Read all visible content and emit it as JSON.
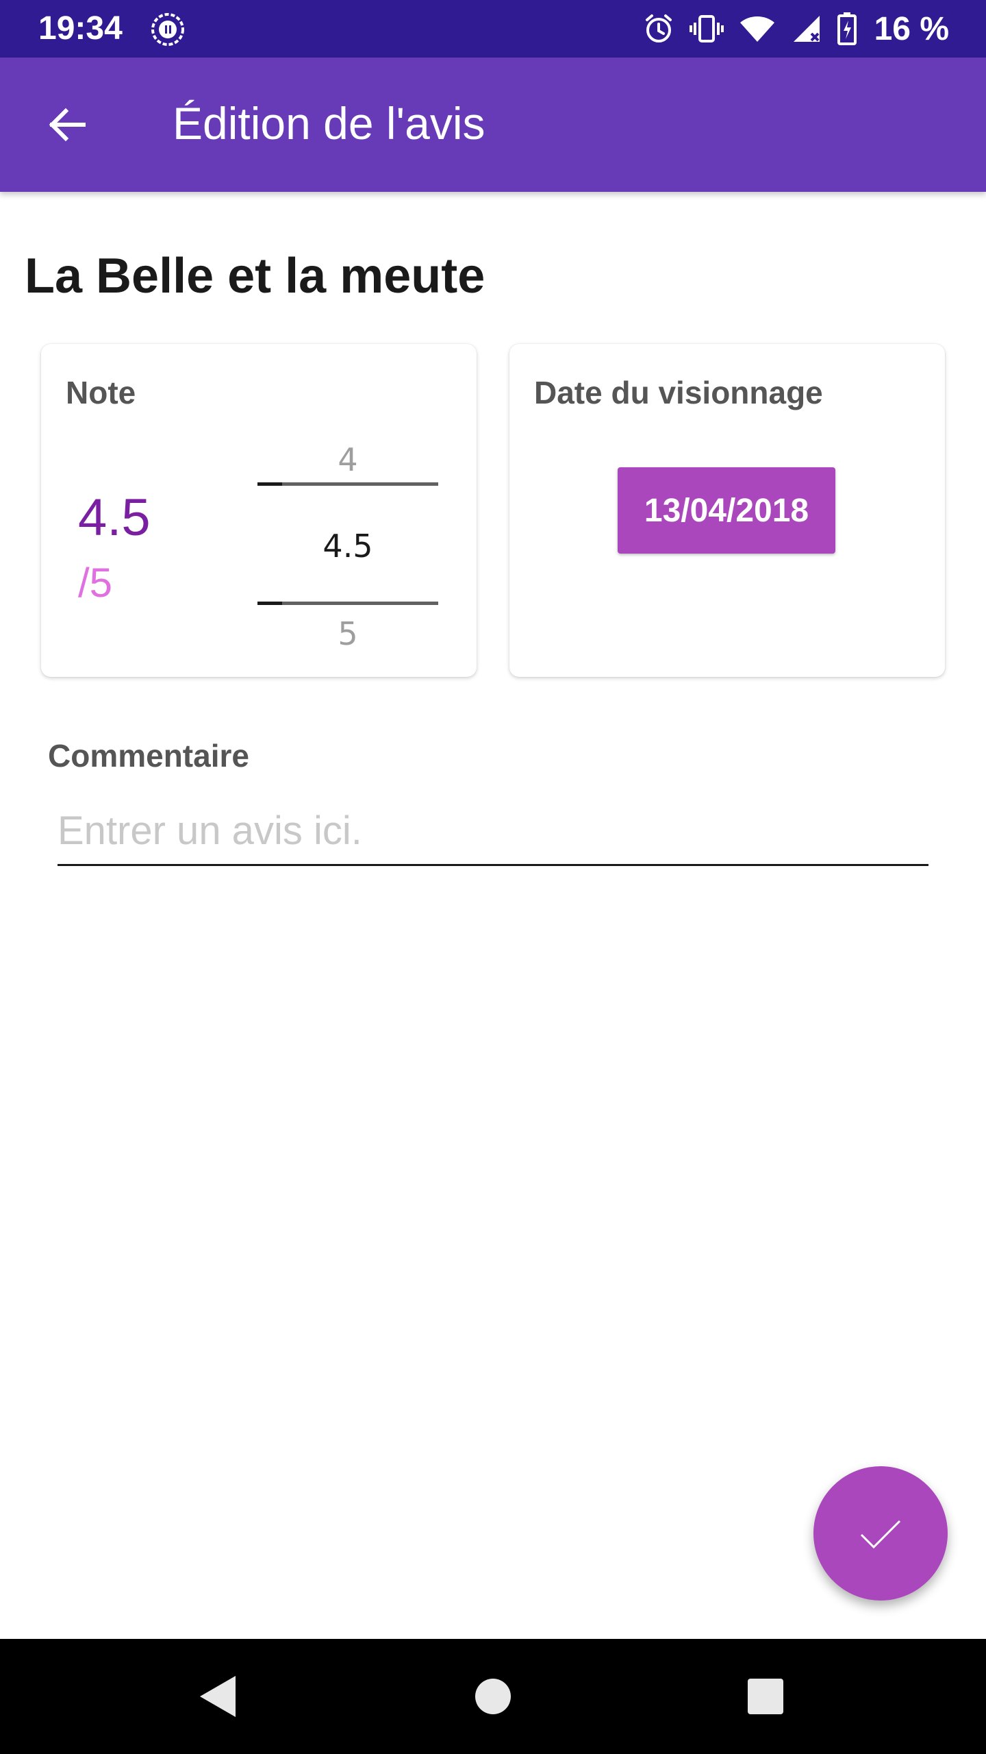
{
  "status_bar": {
    "time": "19:34",
    "battery": "16 %",
    "icons": [
      "app-notification-icon",
      "alarm-icon",
      "vibrate-icon",
      "wifi-icon",
      "signal-icon",
      "battery-charging-icon"
    ]
  },
  "app_bar": {
    "title": "Édition de l'avis",
    "back_icon": "arrow-back-icon",
    "color": "#673ab7"
  },
  "movie": {
    "title": "La Belle et la meute"
  },
  "rating_card": {
    "label": "Note",
    "value": "4.5",
    "scale": "/5",
    "picker": {
      "previous": "4",
      "current": "4.5",
      "next": "5"
    }
  },
  "date_card": {
    "label": "Date du visionnage",
    "date": "13/04/2018"
  },
  "comment": {
    "label": "Commentaire",
    "value": "",
    "placeholder": "Entrer un avis ici."
  },
  "fab": {
    "icon": "check-icon",
    "color": "#ab47bc"
  },
  "nav_bar": {
    "icons": [
      "nav-back-icon",
      "nav-home-icon",
      "nav-recents-icon"
    ]
  }
}
